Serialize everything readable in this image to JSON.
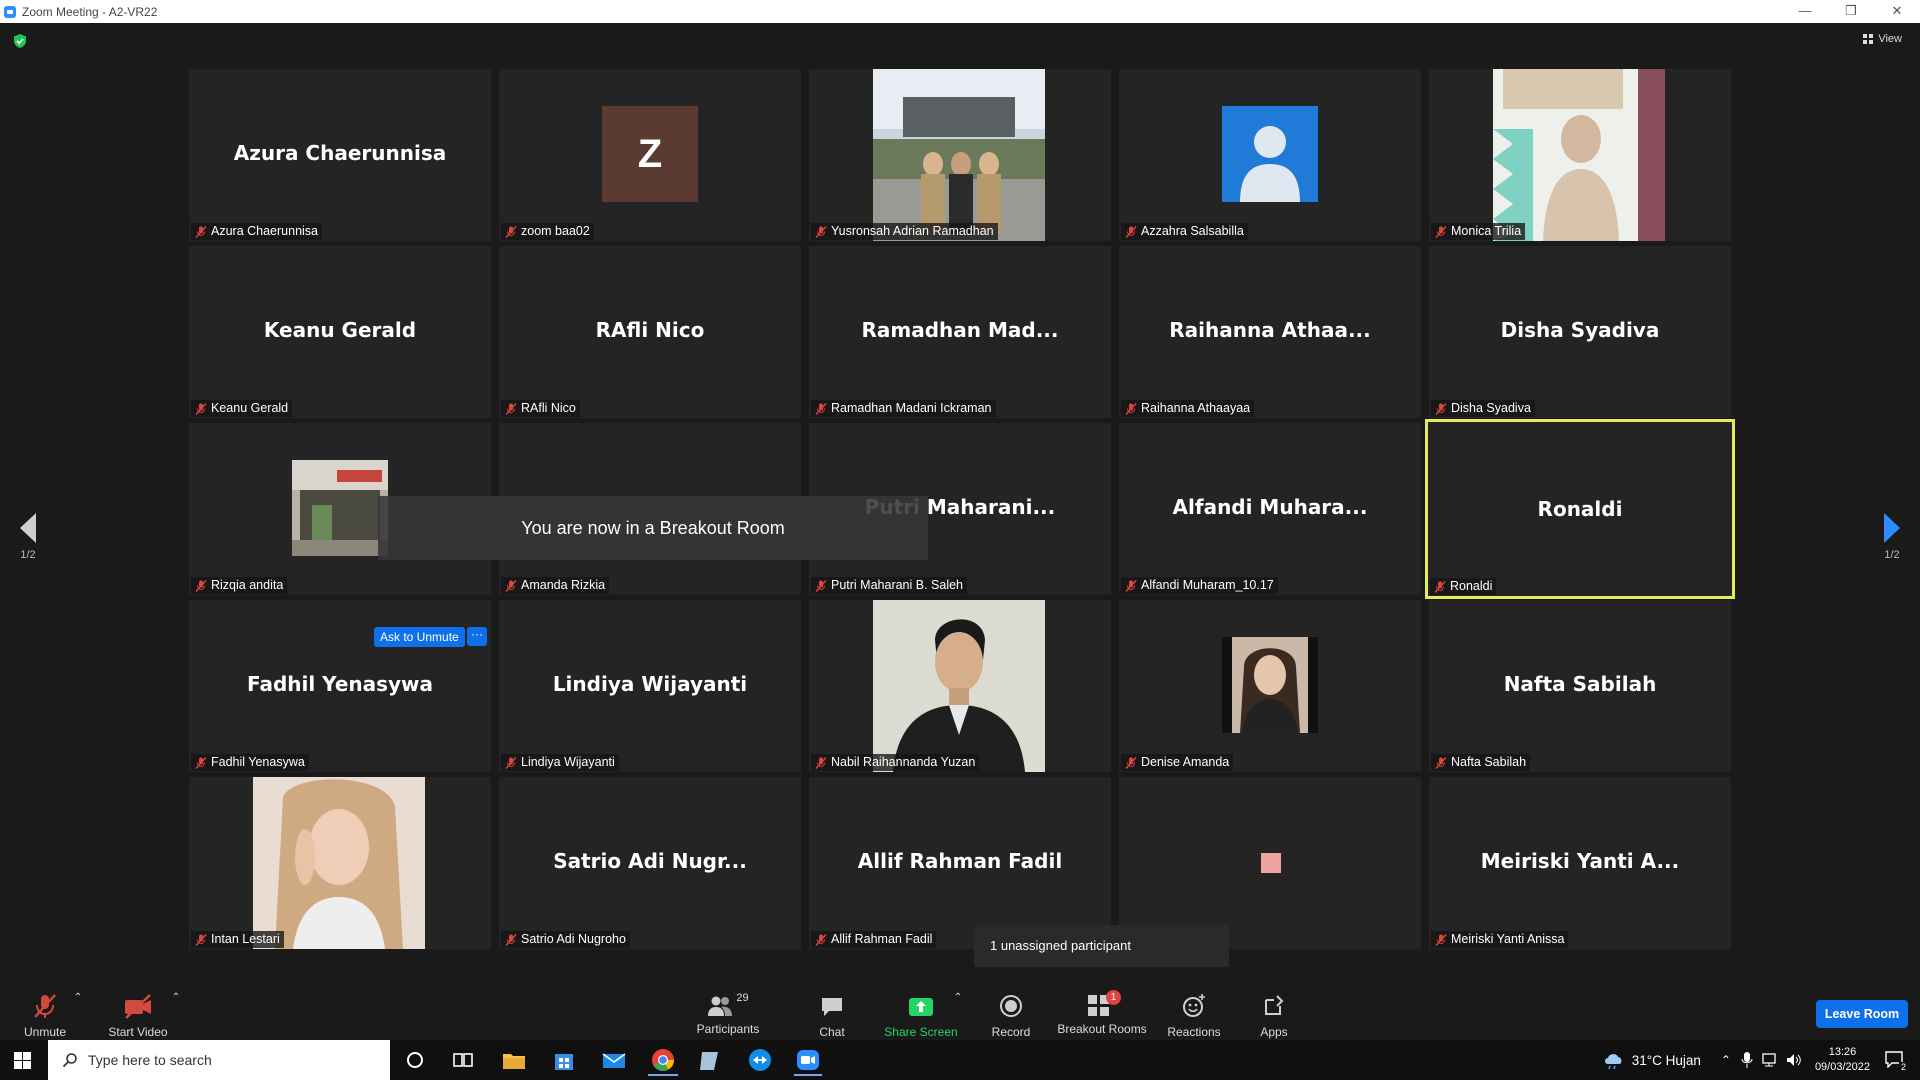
{
  "window": {
    "title": "Zoom Meeting - A2-VR22",
    "controls": [
      "—",
      "❐",
      "✕"
    ]
  },
  "header": {
    "view_label": "View"
  },
  "navigation": {
    "page_left": "1/2",
    "page_right": "1/2"
  },
  "tiles": [
    {
      "display": "Azura Chaerunnisa",
      "label": "Azura Chaerunnisa",
      "kind": "name"
    },
    {
      "display": "Z",
      "label": "zoom baa02",
      "kind": "avatar-letter"
    },
    {
      "display": "",
      "label": "Yusronsah Adrian Ramadhan",
      "kind": "photo"
    },
    {
      "display": "",
      "label": "Azzahra Salsabilla",
      "kind": "avatar-default"
    },
    {
      "display": "",
      "label": "Monica Trilia",
      "kind": "photo"
    },
    {
      "display": "Keanu Gerald",
      "label": "Keanu Gerald",
      "kind": "name"
    },
    {
      "display": "RAfli Nico",
      "label": "RAfli Nico",
      "kind": "name"
    },
    {
      "display": "Ramadhan  Mad...",
      "label": "Ramadhan Madani Ickraman",
      "kind": "name"
    },
    {
      "display": "Raihanna  Athaa...",
      "label": "Raihanna Athaayaa",
      "kind": "name"
    },
    {
      "display": "Disha Syadiva",
      "label": "Disha Syadiva",
      "kind": "name"
    },
    {
      "display": "",
      "label": "Rizqia andita",
      "kind": "photo"
    },
    {
      "display": "",
      "label": "Amanda Rizkia",
      "kind": "name"
    },
    {
      "display": "Putri  Maharani...",
      "label": "Putri Maharani B. Saleh",
      "kind": "name"
    },
    {
      "display": "Alfandi  Muhara...",
      "label": "Alfandi Muharam_10.17",
      "kind": "name"
    },
    {
      "display": "Ronaldi",
      "label": "Ronaldi",
      "kind": "name"
    },
    {
      "display": "Fadhil Yenasywa",
      "label": "Fadhil Yenasywa",
      "kind": "name"
    },
    {
      "display": "Lindiya Wijayanti",
      "label": "Lindiya Wijayanti",
      "kind": "name"
    },
    {
      "display": "",
      "label": "Nabil Raihannanda Yuzan",
      "kind": "photo"
    },
    {
      "display": "",
      "label": "Denise Amanda",
      "kind": "photo"
    },
    {
      "display": "Nafta Sabilah",
      "label": "Nafta Sabilah",
      "kind": "name"
    },
    {
      "display": "",
      "label": "Intan Lestari",
      "kind": "photo"
    },
    {
      "display": "Satrio  Adi  Nugr...",
      "label": "Satrio Adi Nugroho",
      "kind": "name"
    },
    {
      "display": "Allif Rahman Fadil",
      "label": "Allif Rahman Fadil",
      "kind": "name"
    },
    {
      "display": "",
      "label": "",
      "kind": "square"
    },
    {
      "display": "Meiriski  Yanti  A...",
      "label": "Meiriski Yanti Anissa",
      "kind": "name"
    }
  ],
  "overlay": {
    "ask_to_unmute": "Ask to Unmute",
    "more": "···",
    "breakout_toast": "You are now in a Breakout Room",
    "unassigned_tooltip": "1 unassigned participant"
  },
  "toolbar": {
    "unmute": "Unmute",
    "start_video": "Start Video",
    "participants": "Participants",
    "participants_count": "29",
    "chat": "Chat",
    "share_screen": "Share Screen",
    "record": "Record",
    "breakout_rooms": "Breakout Rooms",
    "breakout_badge": "1",
    "reactions": "Reactions",
    "apps": "Apps",
    "leave_room": "Leave Room"
  },
  "taskbar": {
    "search_placeholder": "Type here to search",
    "weather": "31°C  Hujan",
    "time": "13:26",
    "date": "09/03/2022",
    "notifications": "2"
  },
  "colors": {
    "accent": "#0e71eb",
    "active_speaker_border": "#e5eb5f",
    "share_green": "#25d366",
    "mic_red": "#e0443e"
  }
}
